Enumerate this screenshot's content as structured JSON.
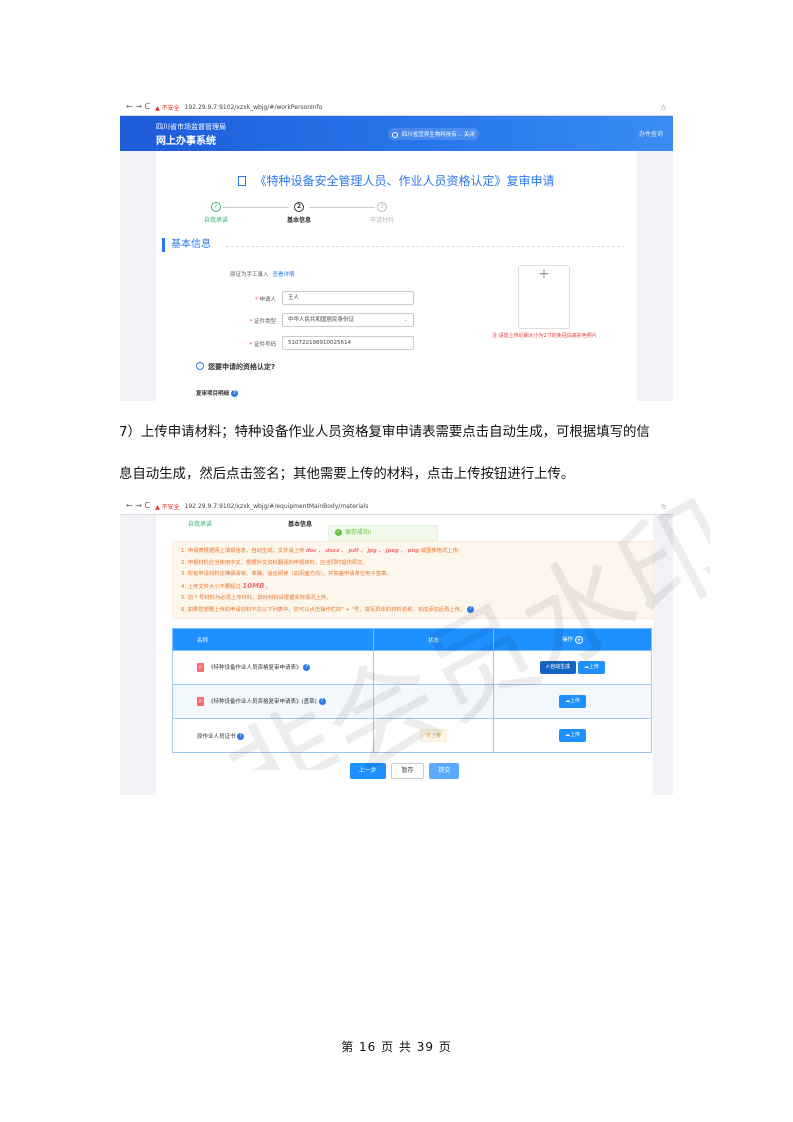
{
  "shot1": {
    "browser": {
      "nav": "← → C",
      "warn": "▲ 不安全",
      "url": "192.29.9.7:9102/xzxk_wbjg/#/workPersonInfo",
      "star": "☆"
    },
    "header": {
      "org": "四川省市场监督管理局",
      "system": "网上办事系统",
      "user": "四川省宜宾生物科技有...",
      "user_action": "关闭",
      "right": "办件查询"
    },
    "title": "《特种设备安全管理人员、作业人员资格认定》复审申请",
    "steps": [
      {
        "icon": "✓",
        "label": "自我承诺"
      },
      {
        "icon": "2",
        "label": "基本信息"
      },
      {
        "icon": "3",
        "label": "申请材料"
      }
    ],
    "section": "基本信息",
    "manual_entry": "原证为手工录入",
    "manual_link": "查看详情",
    "form": {
      "applicant_label": "申请人",
      "applicant_value": "王人",
      "id_type_label": "证件类型",
      "id_type_value": "中华人民共和国居民身份证",
      "id_no_label": "证件号码",
      "id_no_value": "510722198910025614"
    },
    "upload_note": "注:请您上传近期大小为2寸的免冠白底彩色照片",
    "question": "您要申请的资格认定?",
    "item_detail": "复审项目明细"
  },
  "paragraph": {
    "line1": "7）上传申请材料；特种设备作业人员资格复审申请表需要点击自动生成，可根据填写的信",
    "line2": "息自动生成，然后点击签名；其他需要上传的材料，点击上传按钮进行上传。"
  },
  "shot2": {
    "browser": {
      "nav": "← → C",
      "warn": "▲ 不安全",
      "url": "192.29.9.7:9102/xzxk_wbjg/#/equipmentMainBody/materials",
      "star": "☆"
    },
    "steps": {
      "s1": "自我承诺",
      "s2": "基本信息"
    },
    "toast": "保存成功!",
    "notice": {
      "n1_a": "1. 申请表根据网上填报信息，自动生成；文件请上传",
      "n1_formats": "doc 、 docx 、 pdf 、 jpg 、 jpeg 、 png",
      "n1_b": "或图像格式上传;",
      "n2": "2. 申报材料应当使用中文，根据外文资料翻译的申报资料，应当同时提供原文。",
      "n3": "3. 所有申请材料应确保清晰、准确、适合阅读（如页面方向），并加盖申请单位电子签章。",
      "n4_a": "4. 上传文件大小不要超过",
      "n4_size": "10MB",
      "n4_b": "。",
      "n5": "5. 加 * 号材料为必须上传材料，其他材料请根据实际情况上传。",
      "n6": "6. 如果您想要上传的申请材料不在以下列表中，您可以点击操作栏的\" + \"号，填写具体的材料名称，完成添加后再上传。"
    },
    "table": {
      "headers": [
        "名称",
        "状态",
        "操作"
      ],
      "rows": [
        {
          "name": "《特种设备作业人员资格复审申请表》",
          "status": "",
          "ops": [
            "✍自动生成",
            "☁上传"
          ]
        },
        {
          "name": "《特种设备作业人员资格复审申请表》(盖章)",
          "status": "",
          "ops": [
            "☁上传"
          ]
        },
        {
          "name": "原作业人员证书",
          "status": "未上传",
          "ops": [
            "☁上传"
          ]
        }
      ]
    },
    "buttons": {
      "prev": "上一步",
      "save": "暂存",
      "submit": "提交"
    }
  },
  "watermark": "非会员水印",
  "footer": "第 16 页 共 39 页",
  "colors": {
    "primary": "#2a78ee",
    "table_header": "#1e90ff",
    "notice_text": "#e6762a"
  }
}
